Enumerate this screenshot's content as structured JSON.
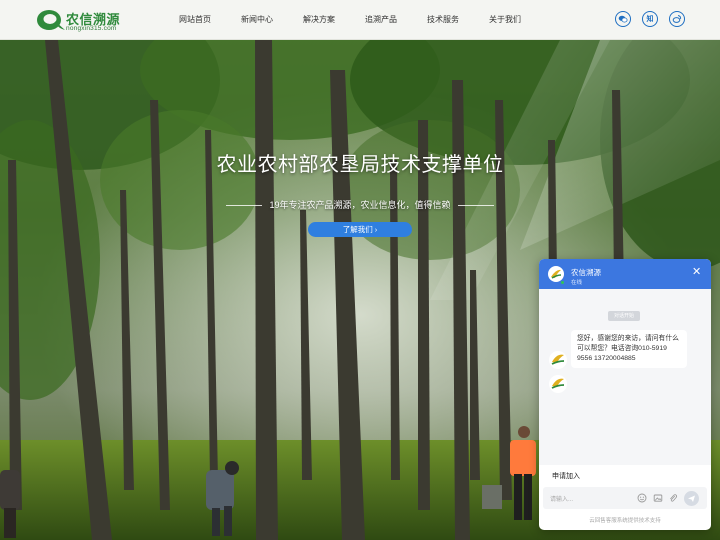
{
  "header": {
    "logo_name": "农信溯源",
    "logo_domain": "nongxin315.com",
    "nav": [
      "网站首页",
      "新闻中心",
      "解决方案",
      "追溯产品",
      "技术服务",
      "关于我们"
    ],
    "icons": [
      {
        "name": "wechat-icon",
        "glyph": ""
      },
      {
        "name": "zhihu-icon",
        "glyph": "知"
      },
      {
        "name": "weibo-icon",
        "glyph": ""
      }
    ]
  },
  "hero": {
    "title": "农业农村部农垦局技术支撑单位",
    "subtitle": "19年专注农产品溯源，农业信息化，值得信赖",
    "button": "了解我们 ›"
  },
  "chat": {
    "name": "农信溯源",
    "status": "在线",
    "time_label": "对话开始",
    "message": "您好，感谢您的来访，请问有什么可以帮您？电话咨询010-5919 9556 13720004885",
    "join": "申请加入",
    "input_placeholder": "请输入...",
    "footer": "云回售客服系统提供技术支持",
    "accent": "#3c77e0"
  }
}
